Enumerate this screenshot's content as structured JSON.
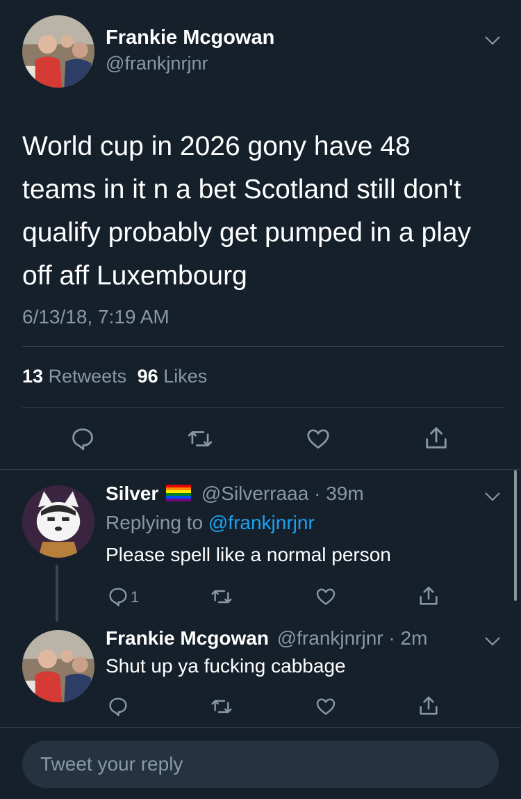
{
  "main_tweet": {
    "display_name": "Frankie Mcgowan",
    "handle": "@frankjnrjnr",
    "text_lines": [
      "World cup in 2026 gony have 48",
      "teams in it n a bet Scotland still don't",
      "qualify probably get pumped in a play",
      "off aff Luxembourg"
    ],
    "timestamp": "6/13/18, 7:19 AM",
    "retweets_count": "13",
    "retweets_label": "Retweets",
    "likes_count": "96",
    "likes_label": "Likes"
  },
  "reply_1": {
    "display_name": "Silver",
    "flag_icon": "rainbow-flag-icon",
    "handle": "@Silverraaa",
    "separator": "·",
    "time": "39m",
    "replying_prefix": "Replying to",
    "replying_handle": "@frankjnrjnr",
    "text": "Please spell like a normal person",
    "reply_count": "1"
  },
  "reply_2": {
    "display_name": "Frankie Mcgowan",
    "handle": "@frankjnrjnr",
    "separator": "·",
    "time": "2m",
    "text": "Shut up ya fucking cabbage"
  },
  "composer": {
    "placeholder": "Tweet your reply"
  },
  "colors": {
    "background": "#15202b",
    "muted": "#8899a6",
    "link": "#1da1f2",
    "divider": "#38444d"
  }
}
